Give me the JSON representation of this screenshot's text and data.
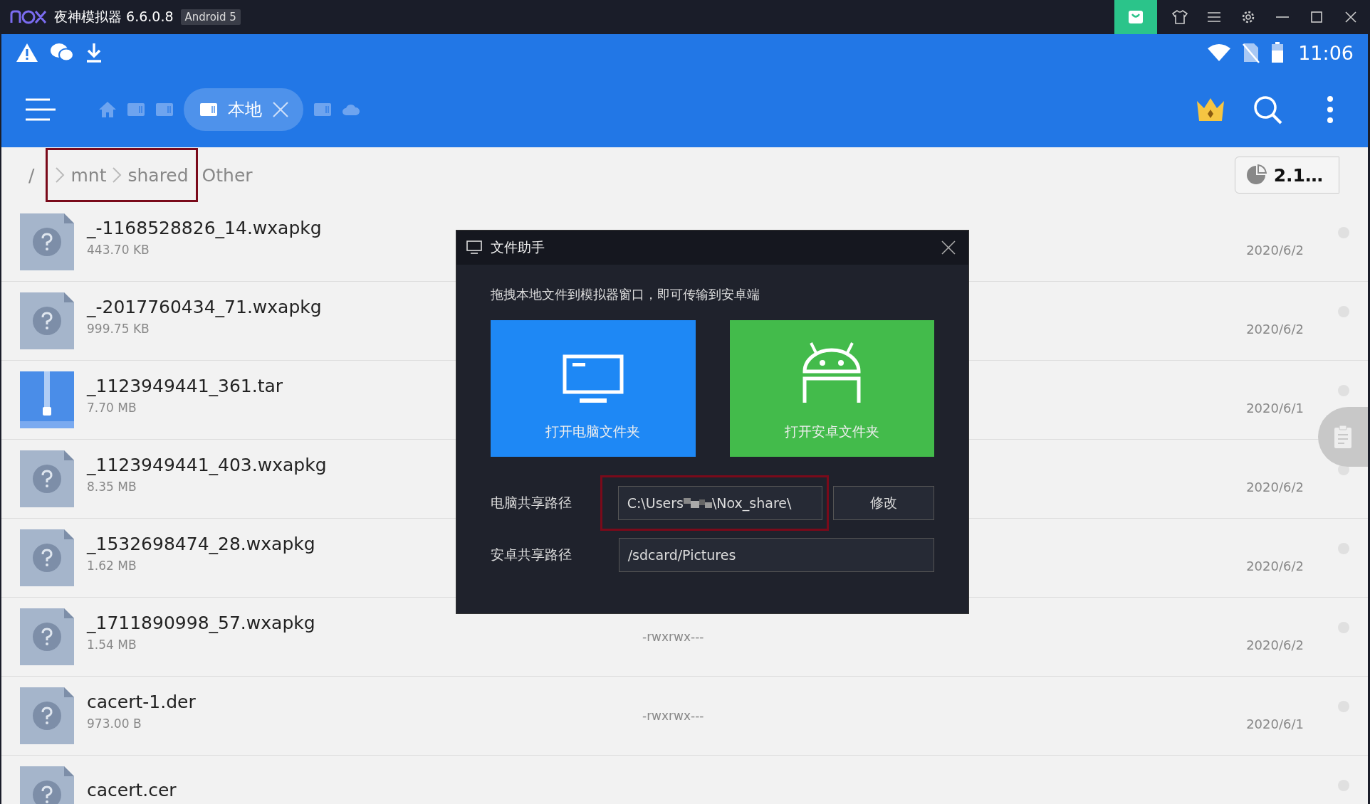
{
  "title_bar": {
    "app_name": "夜神模拟器 6.6.0.8",
    "badge": "Android 5"
  },
  "status_bar": {
    "time": "11:06"
  },
  "app_bar": {
    "tabs": [
      {
        "kind": "home",
        "selected": false
      },
      {
        "kind": "storage",
        "selected": false
      },
      {
        "kind": "storage",
        "selected": false
      },
      {
        "kind": "storage",
        "label": "本地",
        "selected": true
      },
      {
        "kind": "storage",
        "selected": false
      },
      {
        "kind": "cloud",
        "selected": false
      }
    ]
  },
  "breadcrumb": {
    "root": "/",
    "highlighted": [
      "mnt",
      "shared"
    ],
    "rest": [
      "Other"
    ]
  },
  "storage_chip": "2.1…",
  "files": [
    {
      "kind": "unknown",
      "name": "_-1168528826_14.wxapkg",
      "size": "443.70 KB",
      "date": "2020/6/2"
    },
    {
      "kind": "unknown",
      "name": "_-2017760434_71.wxapkg",
      "size": "999.75 KB",
      "date": "2020/6/2"
    },
    {
      "kind": "archive",
      "name": "_1123949441_361.tar",
      "size": "7.70 MB",
      "date": "2020/6/1"
    },
    {
      "kind": "unknown",
      "name": "_1123949441_403.wxapkg",
      "size": "8.35 MB",
      "date": "2020/6/2"
    },
    {
      "kind": "unknown",
      "name": "_1532698474_28.wxapkg",
      "size": "1.62 MB",
      "date": "2020/6/2"
    },
    {
      "kind": "unknown",
      "name": "_1711890998_57.wxapkg",
      "size": "1.54 MB",
      "permissions": "-rwxrwx---",
      "date": "2020/6/2"
    },
    {
      "kind": "unknown",
      "name": "cacert-1.der",
      "size": "973.00 B",
      "permissions": "-rwxrwx---",
      "date": "2020/6/1"
    },
    {
      "kind": "unknown",
      "name": "cacert.cer"
    }
  ],
  "dialog": {
    "title": "文件助手",
    "hint": "拖拽本地文件到模拟器窗口，即可传输到安卓端",
    "buttons": [
      {
        "kind": "pc",
        "label": "打开电脑文件夹"
      },
      {
        "kind": "android",
        "label": "打开安卓文件夹"
      }
    ],
    "pc_path": {
      "label": "电脑共享路径",
      "value_before": "C:\\Users",
      "value_after": "\\Nox_share\\",
      "highlighted": true
    },
    "change_button": "修改",
    "android_path": {
      "label": "安卓共享路径",
      "value": "/sdcard/Pictures"
    }
  }
}
